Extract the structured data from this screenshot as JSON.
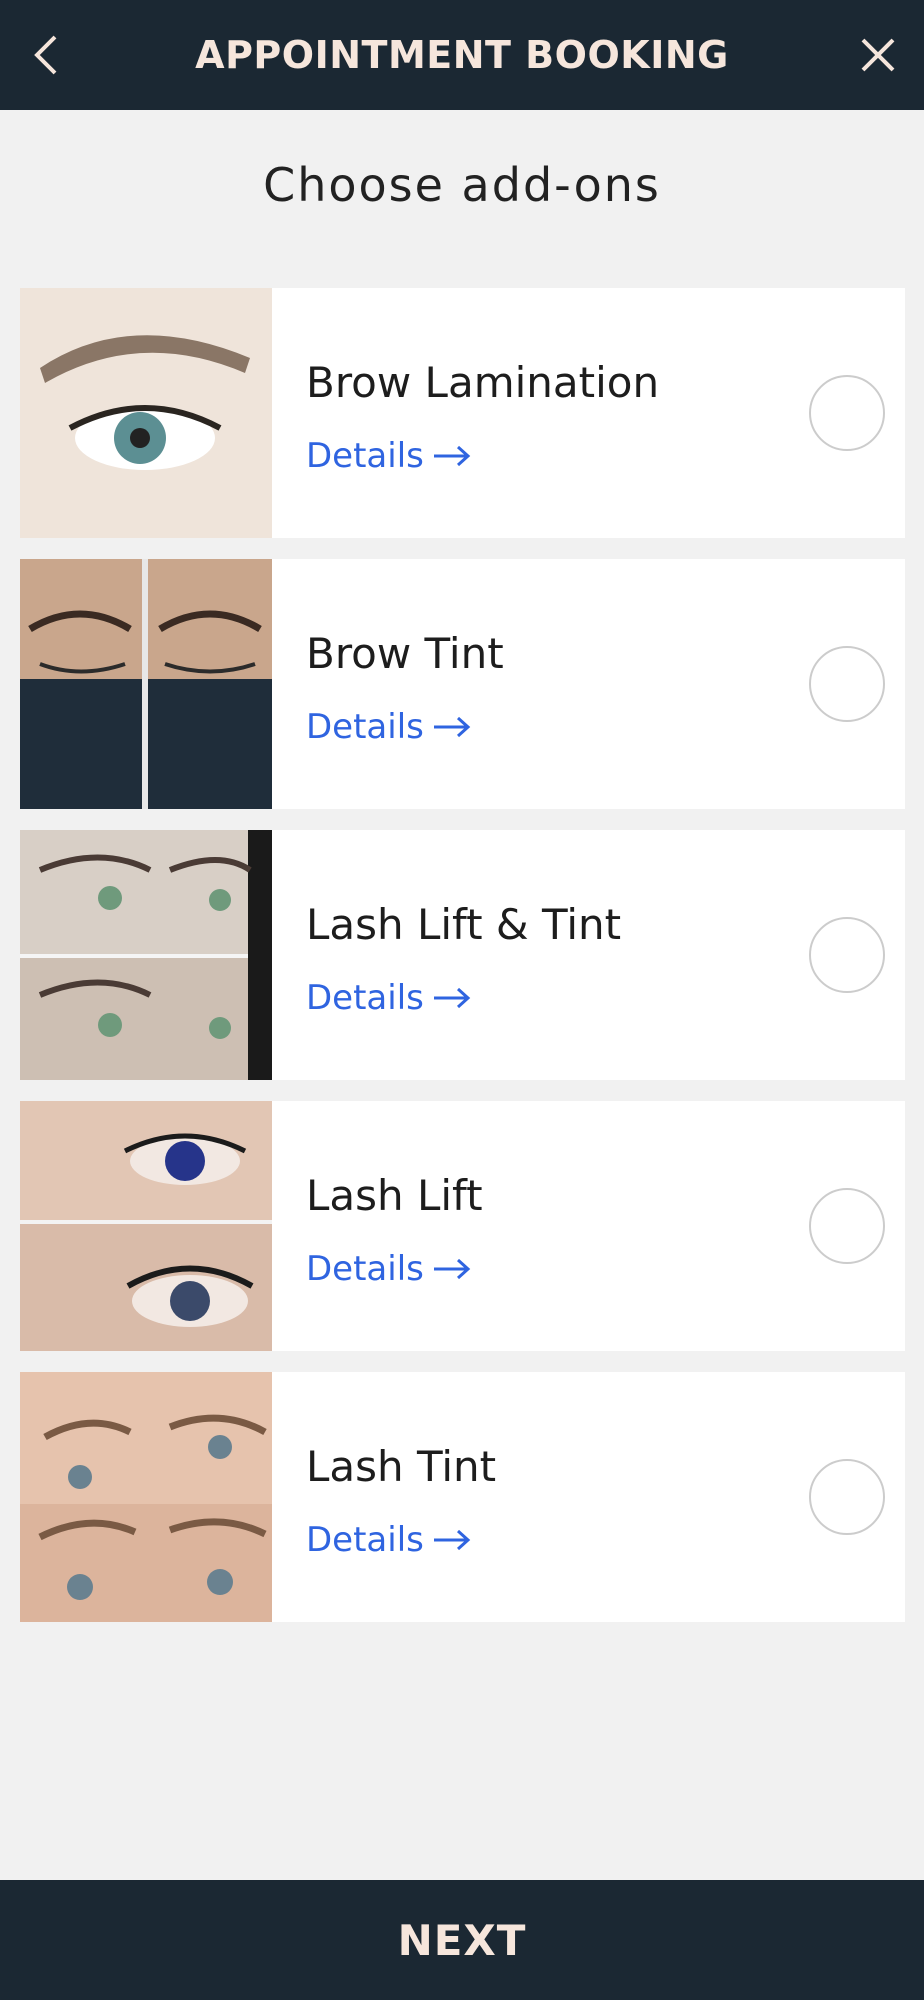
{
  "header": {
    "title": "APPOINTMENT BOOKING",
    "back_icon": "chevron-left-icon",
    "close_icon": "close-icon"
  },
  "subtitle": "Choose add-ons",
  "addons": [
    {
      "name": "Brow Lamination",
      "details_label": "Details",
      "selected": false
    },
    {
      "name": "Brow Tint",
      "details_label": "Details",
      "selected": false
    },
    {
      "name": "Lash Lift & Tint",
      "details_label": "Details",
      "selected": false
    },
    {
      "name": "Lash Lift",
      "details_label": "Details",
      "selected": false
    },
    {
      "name": "Lash Tint",
      "details_label": "Details",
      "selected": false
    }
  ],
  "footer": {
    "next_label": "NEXT"
  },
  "colors": {
    "bar": "#1b2833",
    "bar_text": "#f6e6dc",
    "link": "#2f64e0",
    "background": "#f1f1f1"
  }
}
